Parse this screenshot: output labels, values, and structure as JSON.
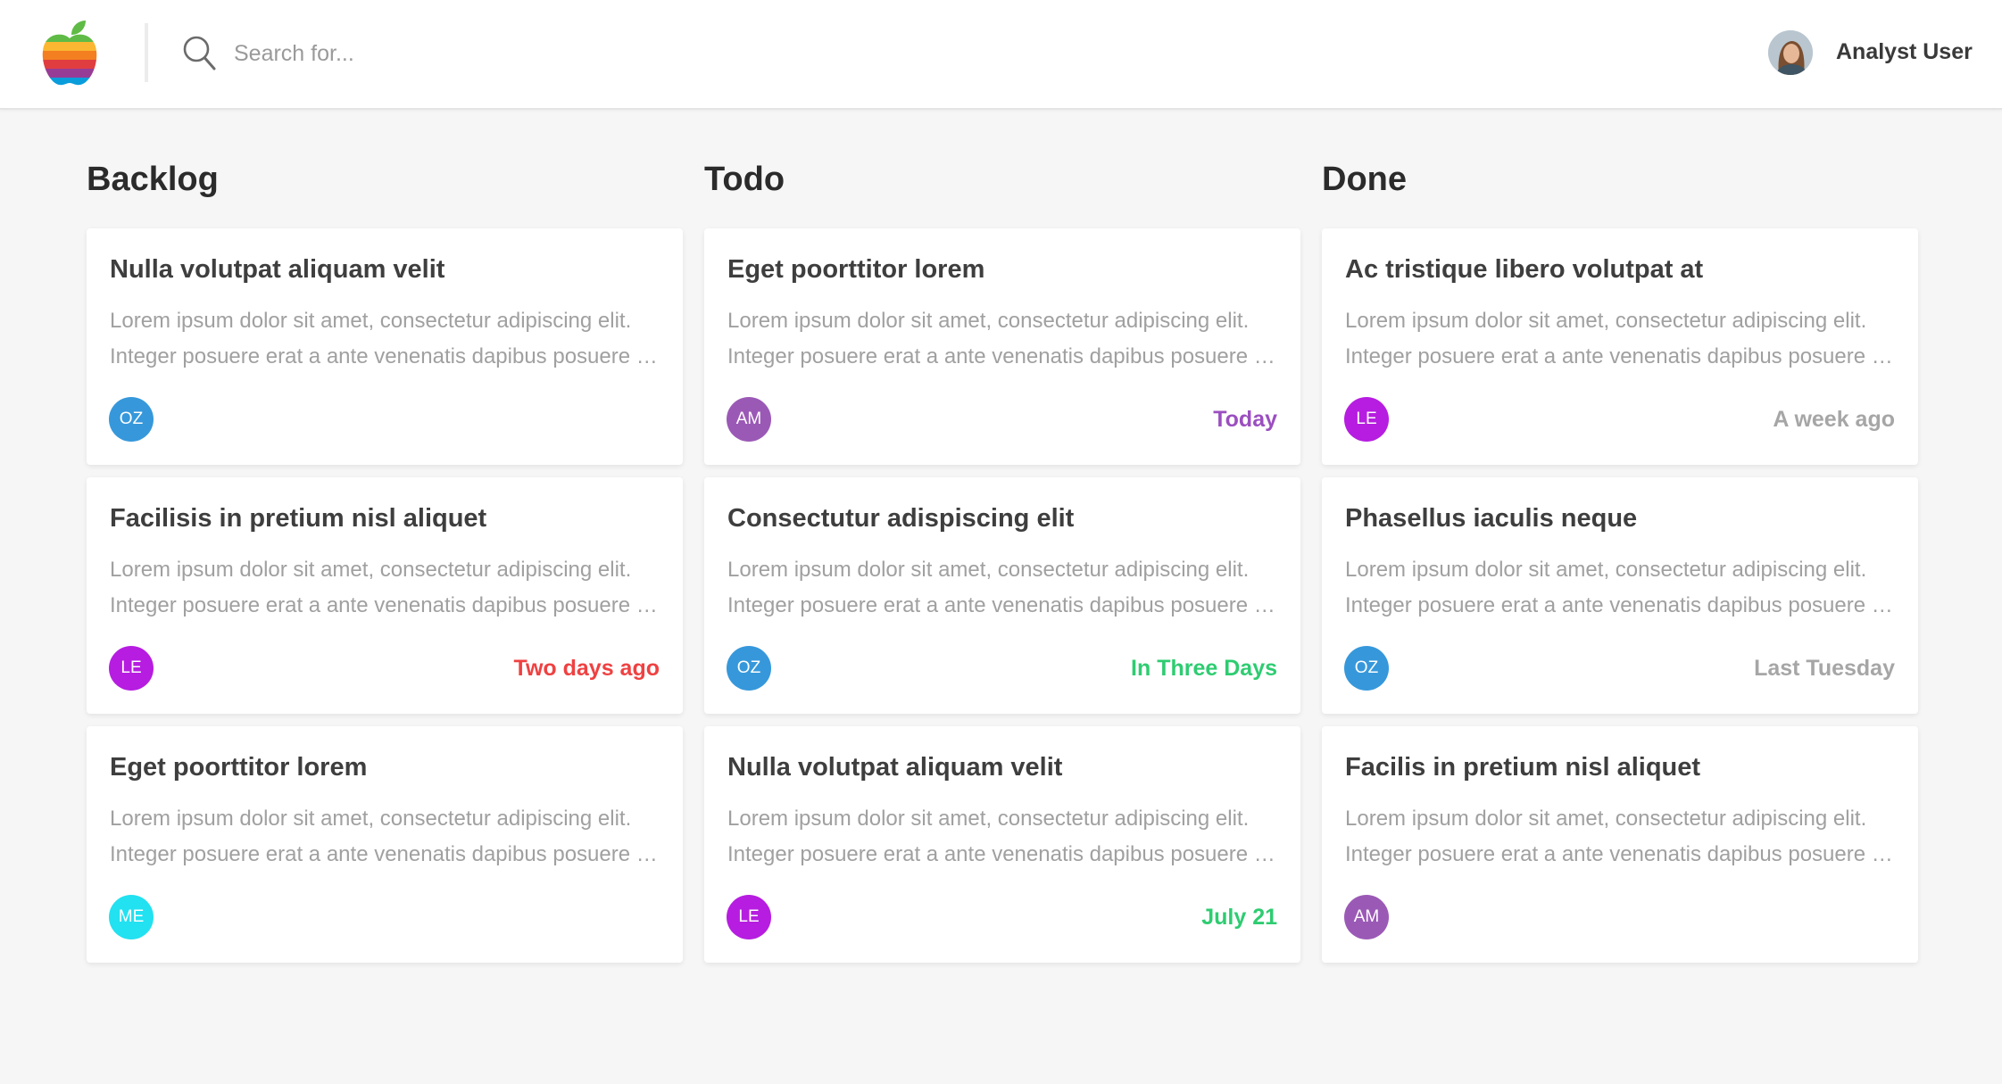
{
  "header": {
    "search_placeholder": "Search for...",
    "user_name": "Analyst User"
  },
  "colors": {
    "OZ": "#3698db",
    "AM": "#9b59b6",
    "LE": "#b61de0",
    "ME": "#22e1f0",
    "today": "#9b4fc0",
    "overdue": "#ef4141",
    "upcoming": "#2ecc71",
    "past": "#a6a6a6"
  },
  "columns": [
    {
      "title": "Backlog",
      "cards": [
        {
          "title": "Nulla volutpat aliquam velit",
          "line1": "Lorem ipsum dolor sit amet, consectetur adipiscing elit.",
          "line2": "Integer posuere erat a ante venenatis dapibus posuere velit aliquet.",
          "initials": "OZ",
          "due": "",
          "due_status": ""
        },
        {
          "title": "Facilisis in pretium nisl aliquet",
          "line1": "Lorem ipsum dolor sit amet, consectetur adipiscing elit.",
          "line2": "Integer posuere erat a ante venenatis dapibus posuere velit aliquet.",
          "initials": "LE",
          "due": "Two days ago",
          "due_status": "overdue"
        },
        {
          "title": "Eget poorttitor lorem",
          "line1": "Lorem ipsum dolor sit amet, consectetur adipiscing elit.",
          "line2": "Integer posuere erat a ante venenatis dapibus posuere velit aliquet.",
          "initials": "ME",
          "due": "",
          "due_status": ""
        }
      ]
    },
    {
      "title": "Todo",
      "cards": [
        {
          "title": "Eget poorttitor lorem",
          "line1": "Lorem ipsum dolor sit amet, consectetur adipiscing elit.",
          "line2": "Integer posuere erat a ante venenatis dapibus posuere velit aliquet.",
          "initials": "AM",
          "due": "Today",
          "due_status": "today"
        },
        {
          "title": "Consectutur adispiscing elit",
          "line1": "Lorem ipsum dolor sit amet, consectetur adipiscing elit.",
          "line2": "Integer posuere erat a ante venenatis dapibus posuere velit aliquet.",
          "initials": "OZ",
          "due": "In Three Days",
          "due_status": "upcoming"
        },
        {
          "title": "Nulla volutpat aliquam velit",
          "line1": "Lorem ipsum dolor sit amet, consectetur adipiscing elit.",
          "line2": "Integer posuere erat a ante venenatis dapibus posuere velit aliquet.",
          "initials": "LE",
          "due": "July 21",
          "due_status": "upcoming"
        }
      ]
    },
    {
      "title": "Done",
      "cards": [
        {
          "title": "Ac tristique libero volutpat at",
          "line1": "Lorem ipsum dolor sit amet, consectetur adipiscing elit.",
          "line2": "Integer posuere erat a ante venenatis dapibus posuere velit aliquet.",
          "initials": "LE",
          "due": "A week ago",
          "due_status": "past"
        },
        {
          "title": "Phasellus iaculis neque",
          "line1": "Lorem ipsum dolor sit amet, consectetur adipiscing elit.",
          "line2": "Integer posuere erat a ante venenatis dapibus posuere velit aliquet.",
          "initials": "OZ",
          "due": "Last Tuesday",
          "due_status": "past"
        },
        {
          "title": "Facilis in pretium nisl aliquet",
          "line1": "Lorem ipsum dolor sit amet, consectetur adipiscing elit.",
          "line2": "Integer posuere erat a ante venenatis dapibus posuere velit aliquet.",
          "initials": "AM",
          "due": "",
          "due_status": ""
        }
      ]
    }
  ]
}
